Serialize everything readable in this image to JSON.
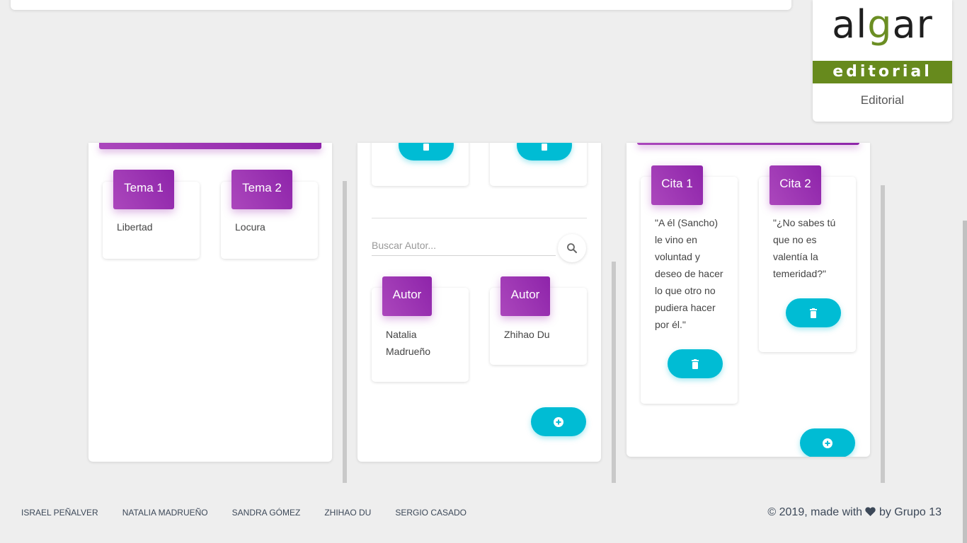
{
  "publisher": {
    "logo_text_left": "al",
    "logo_text_g": "g",
    "logo_text_right": "ar",
    "logo_band": "editorial",
    "label": "Editorial"
  },
  "topics": {
    "cards": [
      {
        "tag": "Tema 1",
        "value": "Libertad"
      },
      {
        "tag": "Tema 2",
        "value": "Locura"
      }
    ]
  },
  "authors": {
    "search_placeholder": "Buscar Autor...",
    "cards": [
      {
        "tag": "Autor",
        "value": "Natalia Madrueño"
      },
      {
        "tag": "Autor",
        "value": "Zhihao Du"
      }
    ],
    "delete_icon": "trash-icon",
    "add_icon": "plus-circle-icon"
  },
  "quotes": {
    "cards": [
      {
        "tag": "Cita 1",
        "value": "\"A él (Sancho) le vino en voluntad y deseo de hacer lo que otro no pudiera hacer por él.\""
      },
      {
        "tag": "Cita 2",
        "value": "\"¿No sabes tú que no es valentía la temeridad?\""
      }
    ]
  },
  "footer": {
    "links": [
      "ISRAEL PEÑALVER",
      "NATALIA MADRUEÑO",
      "SANDRA GÓMEZ",
      "ZHIHAO DU",
      "SERGIO CASADO"
    ],
    "copyright_pre": "© 2019, made with",
    "copyright_post": "by Grupo 13"
  },
  "colors": {
    "accent_purple": "#9c27b0",
    "accent_cyan": "#00bcd4",
    "brand_green": "#678a1d"
  }
}
